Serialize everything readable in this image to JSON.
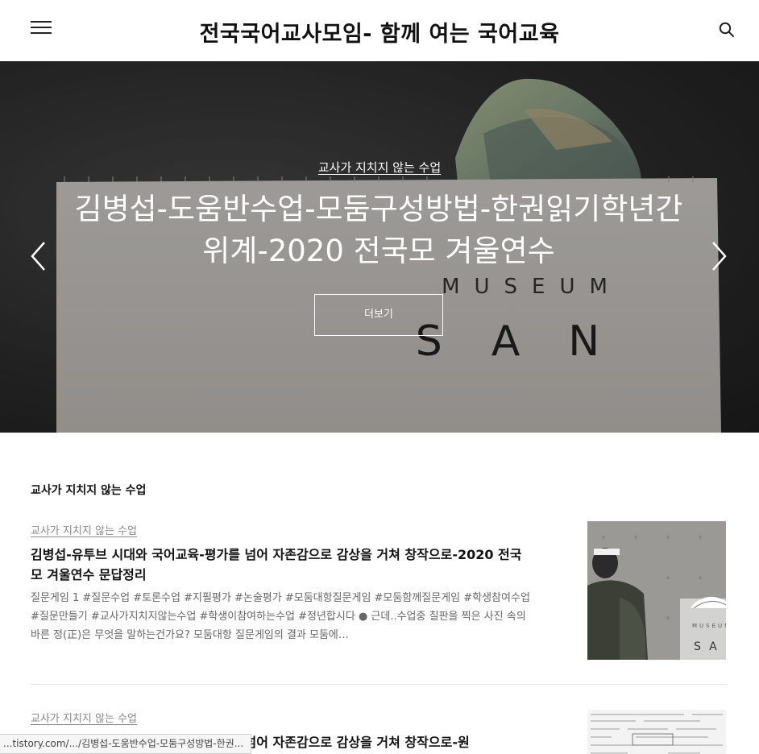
{
  "header": {
    "site_title": "전국국어교사모임- 함께 여는 국어교육"
  },
  "hero": {
    "category": "교사가 지치지 않는 수업",
    "title": "김병섭-도움반수업-모둠구성방법-한권읽기학년간위계-2020 전국모 겨울연수",
    "more_label": "더보기",
    "photo_text_line1": "MUSEUM",
    "photo_text_line2": "SAN"
  },
  "section": {
    "title": "교사가 지치지 않는 수업"
  },
  "posts": [
    {
      "category": "교사가 지치지 않는 수업",
      "title": "김병섭-유투브 시대와 국어교육-평가를 넘어 자존감으로 감상을 거쳐 창작으로-2020 전국모 겨울연수 문답정리",
      "excerpt": "질문게임 1 #질문수업 #토론수업 #지필평가 #논술평가 #모둠대항질문게임 #모둠함께질문게임 #학생참여수업 #질문만들기 #교사가지치지않는수업 #학생이참여하는수업 #정년합시다 ● 근데..수업중 칠판을 찍은 사진 속의 바른 정(正)은 무엇을 말하는건가요?  모둠대항 질문게임의 결과 모둠에…",
      "thumb_text_line1": "MUSEUM",
      "thumb_text_line2": "SAN"
    },
    {
      "category": "교사가 지치지 않는 수업",
      "title": "김병섭-유투브 시대와 국어교육-평가를 넘어 자존감으로 감상을 거쳐 창작으로-원"
    }
  ],
  "status_bar": {
    "url": "...tistory.com/.../김병섭-도움반수업-모둠구성방법-한권..."
  },
  "colors": {
    "header_bg": "#ffffff",
    "text_primary": "#111111",
    "text_meta": "#888888",
    "hero_text": "#ffffff"
  },
  "icons": {
    "menu": "hamburger-icon",
    "search": "search-icon",
    "prev": "chevron-left-icon",
    "next": "chevron-right-icon"
  }
}
